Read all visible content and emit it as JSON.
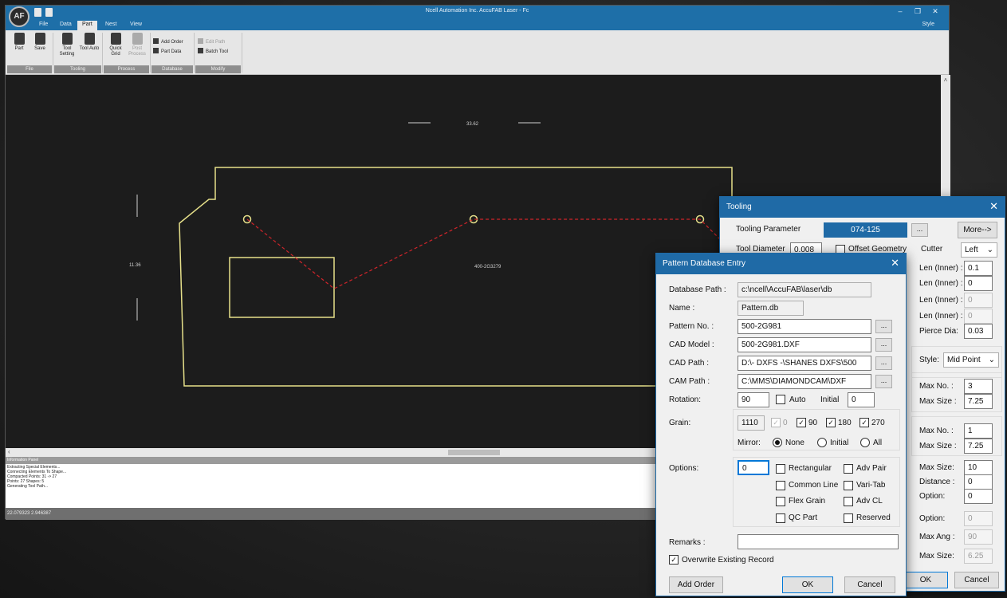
{
  "app": {
    "logo": "AF",
    "title": "Ncell Automation Inc. AccuFAB Laser - Fc",
    "menus": [
      "File",
      "Data",
      "Part",
      "Nest",
      "View"
    ],
    "active_menu": "Part",
    "style_label": "Style",
    "window_controls": {
      "minimize": "–",
      "maximize": "❐",
      "close": "✕"
    }
  },
  "ribbon": {
    "file_buttons": [
      {
        "label": "Part",
        "icon": "part-icon"
      },
      {
        "label": "Save",
        "icon": "save-icon"
      }
    ],
    "tooling_buttons": [
      {
        "label": "Tool Setting",
        "icon": "tool-setting-icon"
      },
      {
        "label": "Tool Auto",
        "icon": "tool-auto-icon"
      }
    ],
    "process_buttons": [
      {
        "label": "Quick Grid",
        "icon": "grid-icon"
      },
      {
        "label": "Post Process",
        "icon": "post-process-icon"
      }
    ],
    "database_items": [
      "Add Order",
      "Part Data"
    ],
    "modify_items": [
      "Edit Path",
      "Batch Tool"
    ],
    "groups": [
      "File",
      "Tooling",
      "Process",
      "Database",
      "Modify"
    ]
  },
  "canvas": {
    "dim_width": "33.62",
    "dim_height": "11.36",
    "part_label": "400-2G3279",
    "colors": {
      "outline": "#e6e08a",
      "cut_path": "#d0242a",
      "dim": "#cfcfcf",
      "background": "#1c1c1c"
    }
  },
  "info_panel": {
    "header": "Information Panel",
    "lines": [
      "Extracting Special Elements...",
      "Connecting Elements To Shape...",
      "Compacted Points:   31 ->    27",
      "Points:  27 Shapes:   5",
      "Generating Tool Path..."
    ]
  },
  "status": {
    "coords": "22.079323 2.946387"
  },
  "tooling": {
    "title": "Tooling",
    "param_label": "Tooling Parameter",
    "param_value": "074-125",
    "more_label": "More-->",
    "tool_diameter_label": "Tool Diameter",
    "tool_diameter_value": "0.008",
    "offset_geometry_label": "Offset Geometry",
    "cutter_label": "Cutter",
    "cutter_value": "Left",
    "len_inner_label": "Len (Inner) :",
    "len_values": [
      "0.1",
      "0",
      "0",
      "0"
    ],
    "pierce_dia_label": "Pierce Dia:",
    "pierce_dia_value": "0.03",
    "style_label": "Style:",
    "style_value": "Mid Point",
    "max_no_label": "Max No. :",
    "max_size_label": "Max Size :",
    "group1": {
      "max_no": "3",
      "max_size": "7.25"
    },
    "group2": {
      "max_no": "1",
      "max_size": "7.25"
    },
    "max_size_label2": "Max Size:",
    "max_size_value": "10",
    "distance_label": "Distance :",
    "distance_value": "0",
    "option_label": "Option:",
    "option_value": "0",
    "option_value2": "0",
    "max_ang_label": "Max Ang :",
    "max_ang_value": "90",
    "max_size_value3": "6.25",
    "ok_label": "OK",
    "cancel_label": "Cancel"
  },
  "pattern": {
    "title": "Pattern Database Entry",
    "database_path_label": "Database Path :",
    "database_path": "c:\\ncell\\AccuFAB\\laser\\db",
    "name_label": "Name :",
    "name": "Pattern.db",
    "pattern_no_label": "Pattern No. :",
    "pattern_no": "500-2G981",
    "cad_model_label": "CAD Model :",
    "cad_model": "500-2G981.DXF",
    "cad_path_label": "CAD Path :",
    "cad_path": "D:\\- DXFS -\\SHANES DXFS\\500",
    "cam_path_label": "CAM Path :",
    "cam_path": "C:\\MMS\\DIAMONDCAM\\DXF",
    "browse_label": "...",
    "rotation_label": "Rotation:",
    "rotation": "90",
    "auto_label": "Auto",
    "initial_label": "Initial",
    "initial_value": "0",
    "grain_label": "Grain:",
    "grain": "1110",
    "grain_options": [
      {
        "label": "0",
        "checked": true,
        "disabled": true
      },
      {
        "label": "90",
        "checked": true,
        "disabled": false
      },
      {
        "label": "180",
        "checked": true,
        "disabled": false
      },
      {
        "label": "270",
        "checked": true,
        "disabled": false
      }
    ],
    "mirror_label": "Mirror:",
    "mirror_options": [
      "None",
      "Initial",
      "All"
    ],
    "mirror_selected": "None",
    "options_label": "Options:",
    "options_value": "0",
    "option_checks": [
      "Rectangular",
      "Adv Pair",
      "Common Line",
      "Vari-Tab",
      "Flex Grain",
      "Adv CL",
      "QC Part",
      "Reserved"
    ],
    "remarks_label": "Remarks :",
    "remarks": "",
    "overwrite_label": "Overwrite Existing Record",
    "overwrite_checked": true,
    "add_order_label": "Add Order",
    "ok_label": "OK",
    "cancel_label": "Cancel",
    "check_mark": "✓"
  }
}
